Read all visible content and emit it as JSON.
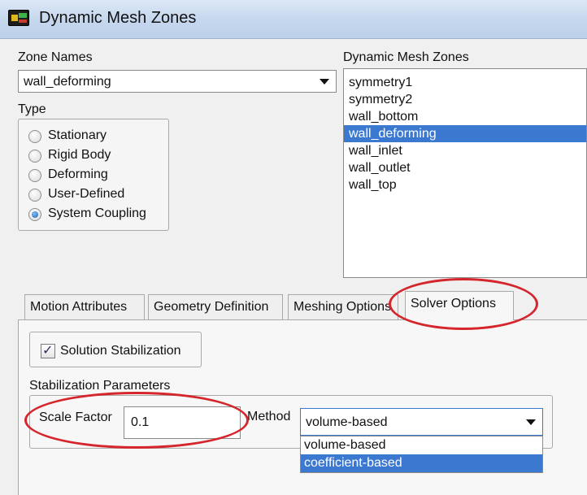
{
  "window": {
    "title": "Dynamic Mesh Zones"
  },
  "zone_names": {
    "label": "Zone Names",
    "value": "wall_deforming"
  },
  "type_group": {
    "label": "Type",
    "options": [
      {
        "label": "Stationary",
        "selected": false
      },
      {
        "label": "Rigid Body",
        "selected": false
      },
      {
        "label": "Deforming",
        "selected": false
      },
      {
        "label": "User-Defined",
        "selected": false
      },
      {
        "label": "System Coupling",
        "selected": true
      }
    ]
  },
  "zones_list": {
    "label": "Dynamic Mesh Zones",
    "items": [
      "symmetry1",
      "symmetry2",
      "wall_bottom",
      "wall_deforming",
      "wall_inlet",
      "wall_outlet",
      "wall_top"
    ],
    "selected": "wall_deforming"
  },
  "tabs": [
    {
      "label": "Motion Attributes"
    },
    {
      "label": "Geometry Definition"
    },
    {
      "label": "Meshing Options"
    },
    {
      "label": "Solver Options",
      "active": true
    }
  ],
  "solver_options": {
    "stabilization_checkbox": {
      "label": "Solution Stabilization",
      "checked": true
    },
    "parameters_label": "Stabilization Parameters",
    "scale_factor": {
      "label": "Scale Factor",
      "value": "0.1"
    },
    "method": {
      "label": "Method",
      "value": "volume-based",
      "options": [
        "volume-based",
        "coefficient-based"
      ],
      "highlighted": "coefficient-based"
    }
  },
  "colors": {
    "annotation": "#d4262c",
    "selection": "#3b78d0"
  }
}
